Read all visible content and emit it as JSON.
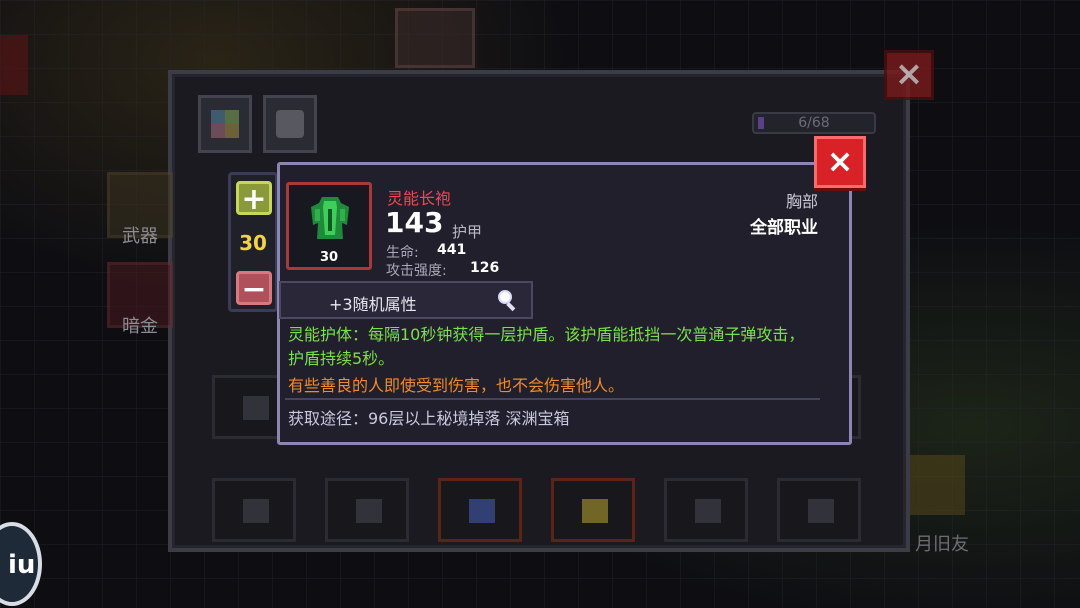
{
  "detail": {
    "item_name": "灵能长袍",
    "armor_value": "143",
    "armor_label": "护甲",
    "level": "30",
    "stats": [
      {
        "label": "生命:",
        "value": "441"
      },
      {
        "label": "攻击强度:",
        "value": "126"
      }
    ],
    "slot_type": "胸部",
    "class_req": "全部职业",
    "random_attr": "+3随机属性",
    "desc_green": "灵能护体：每隔10秒钟获得一层护盾。该护盾能抵挡一次普通子弹攻击，护盾持续5秒。",
    "desc_orange": "有些善良的人即使受到伤害，也不会伤害他人。",
    "source": "获取途径：96层以上秘境掉落 深渊宝箱",
    "close_icon": "×"
  },
  "stepper": {
    "plus": "+",
    "minus": "−",
    "value": "30"
  },
  "inventory": {
    "counter": "6/68",
    "close_icon": "×",
    "side_labels": [
      "武器",
      "暗金"
    ]
  },
  "background": {
    "right_label": "月旧友"
  },
  "fab": {
    "glyph": "iu"
  },
  "colors": {
    "item_name": "#f0484e",
    "desc_green": "#7ae04a",
    "desc_orange": "#f08a2a",
    "stepper_value": "#f2d24a",
    "close_red": "#d82228"
  }
}
